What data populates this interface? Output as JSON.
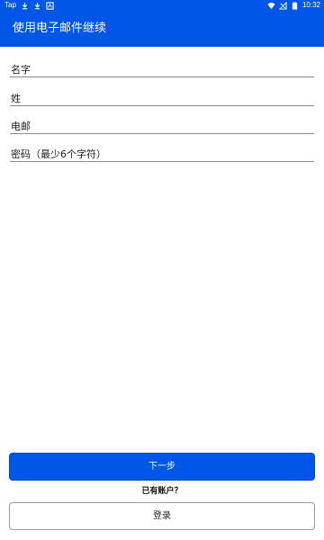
{
  "status_bar": {
    "carrier": "Tap",
    "time": "10:32"
  },
  "app_bar": {
    "title": "使用电子邮件继续"
  },
  "form": {
    "first_name_placeholder": "名字",
    "last_name_placeholder": "姓",
    "email_placeholder": "电邮",
    "password_placeholder": "密码（最少6个字符）"
  },
  "actions": {
    "next_label": "下一步",
    "have_account_text": "已有账户？",
    "login_label": "登录"
  },
  "colors": {
    "primary": "#0057e7",
    "text": "#212121",
    "underline": "#8a8a8a"
  }
}
